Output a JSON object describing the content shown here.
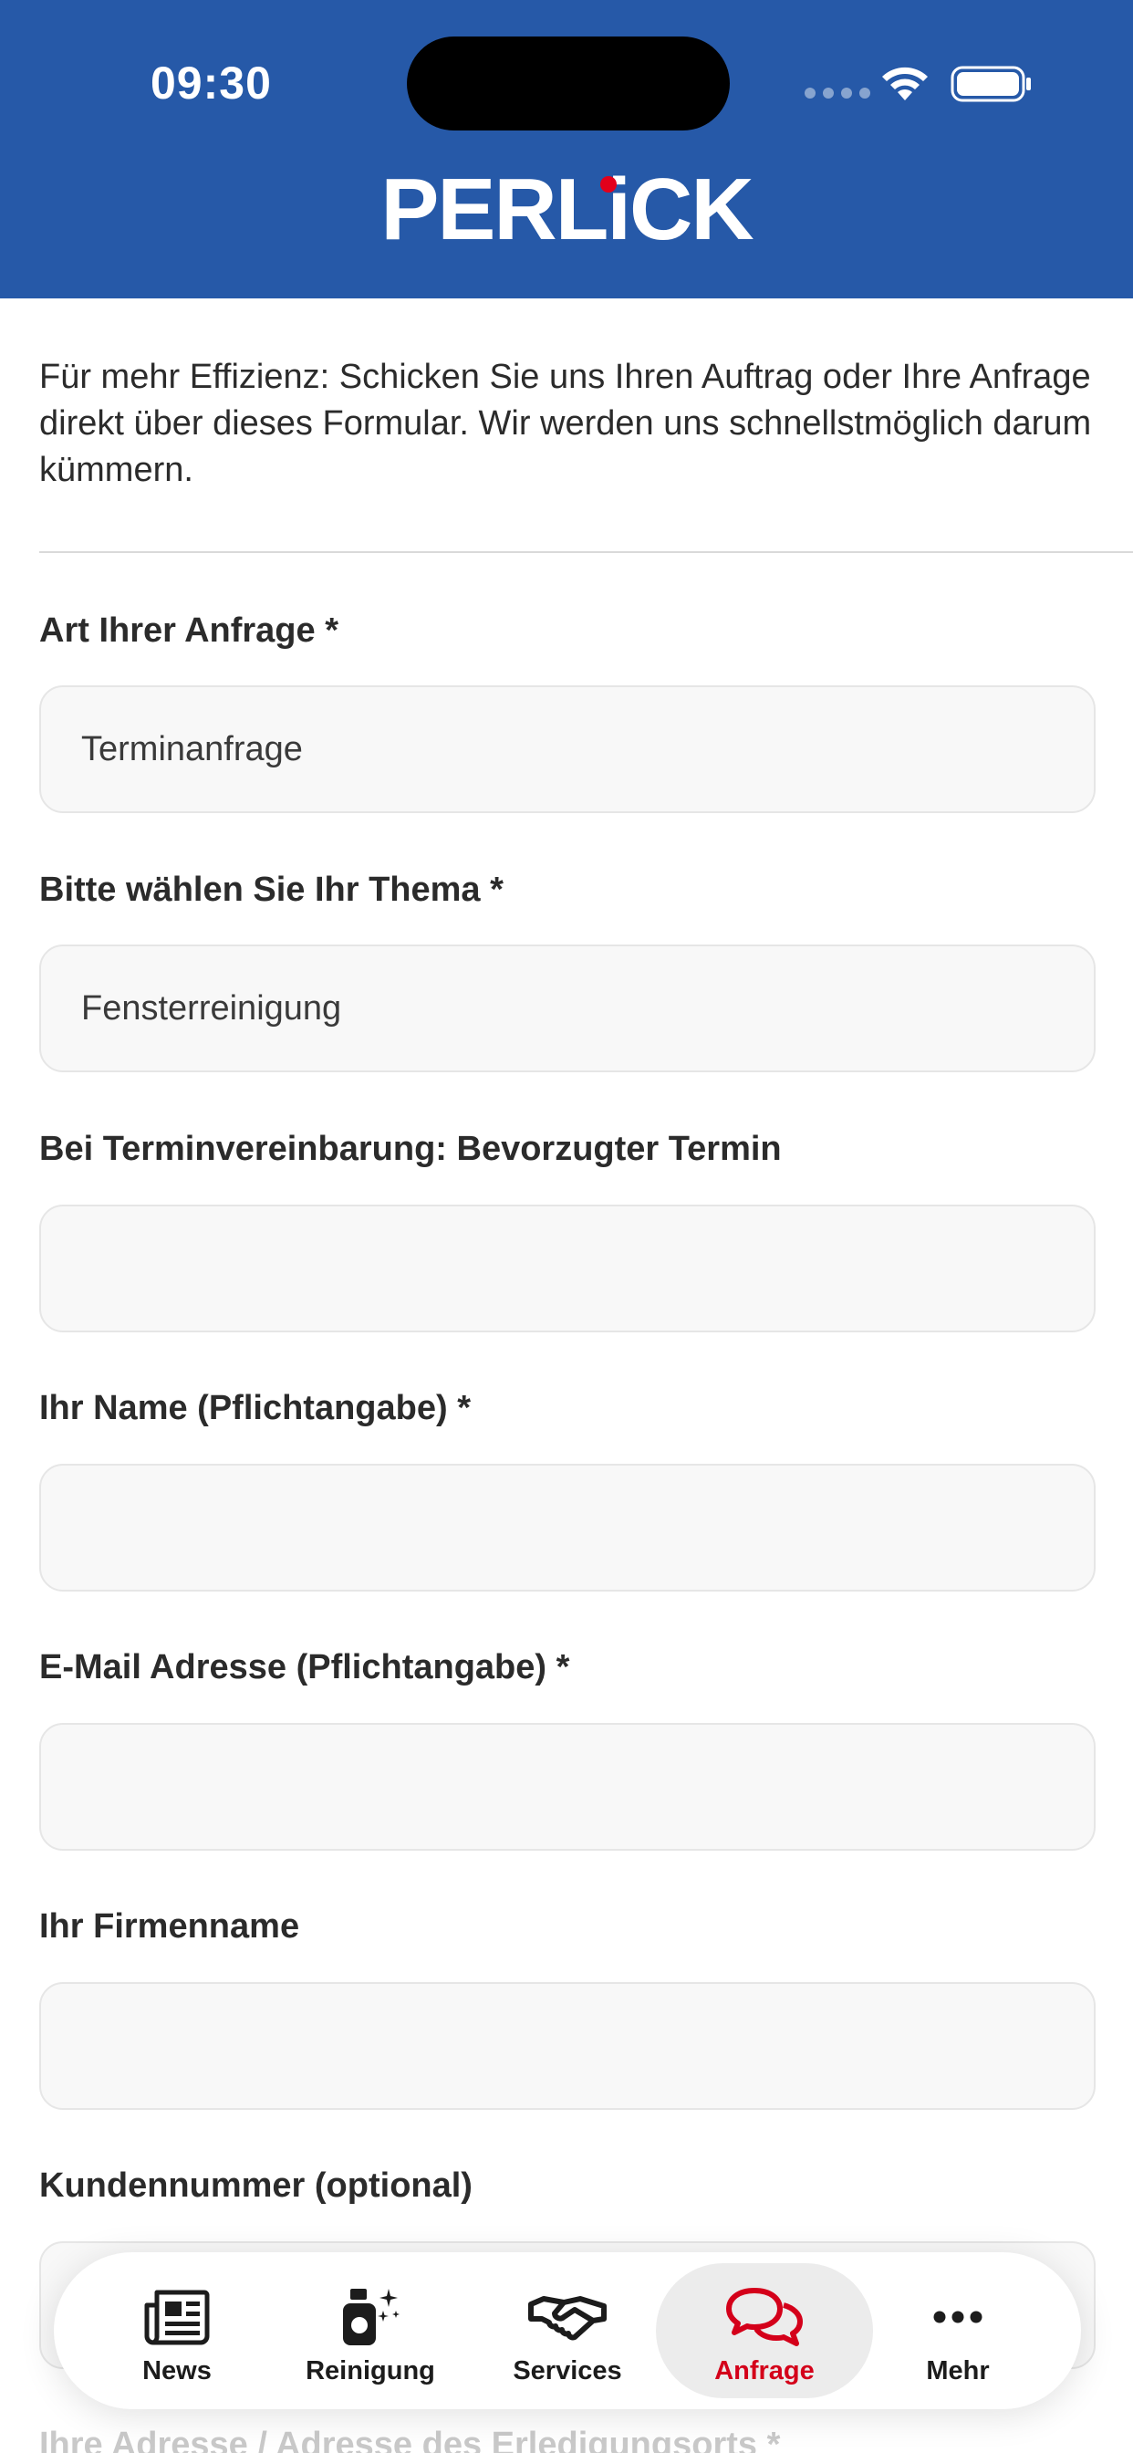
{
  "status_bar": {
    "time": "09:30"
  },
  "header": {
    "logo_text": "PERLiCK"
  },
  "intro_text": "Für mehr Effizienz: Schicken Sie uns Ihren Auftrag oder Ihre Anfrage direkt über dieses Formular. Wir werden uns schnellstmöglich darum kümmern.",
  "form": {
    "fields": [
      {
        "label": "Art Ihrer Anfrage *",
        "value": "Terminanfrage"
      },
      {
        "label": "Bitte wählen Sie Ihr Thema *",
        "value": "Fensterreinigung"
      },
      {
        "label": "Bei Terminvereinbarung: Bevorzugter Termin",
        "value": ""
      },
      {
        "label": "Ihr Name (Pflichtangabe) *",
        "value": ""
      },
      {
        "label": "E-Mail Adresse (Pflichtangabe) *",
        "value": ""
      },
      {
        "label": "Ihr Firmenname",
        "value": ""
      },
      {
        "label": "Kundennummer (optional)",
        "value": ""
      },
      {
        "label": "Ihre Adresse / Adresse des Erledigungsorts *",
        "value": ""
      }
    ]
  },
  "tabbar": {
    "tabs": [
      {
        "label": "News",
        "icon": "newspaper-icon",
        "active": false
      },
      {
        "label": "Reinigung",
        "icon": "spray-bottle-icon",
        "active": false
      },
      {
        "label": "Services",
        "icon": "handshake-icon",
        "active": false
      },
      {
        "label": "Anfrage",
        "icon": "chat-bubbles-icon",
        "active": true
      },
      {
        "label": "Mehr",
        "icon": "more-dots-icon",
        "active": false
      }
    ]
  },
  "colors": {
    "header_bg": "#2659a8",
    "accent_red": "#d4001a",
    "field_bg": "#f8f8f8"
  }
}
